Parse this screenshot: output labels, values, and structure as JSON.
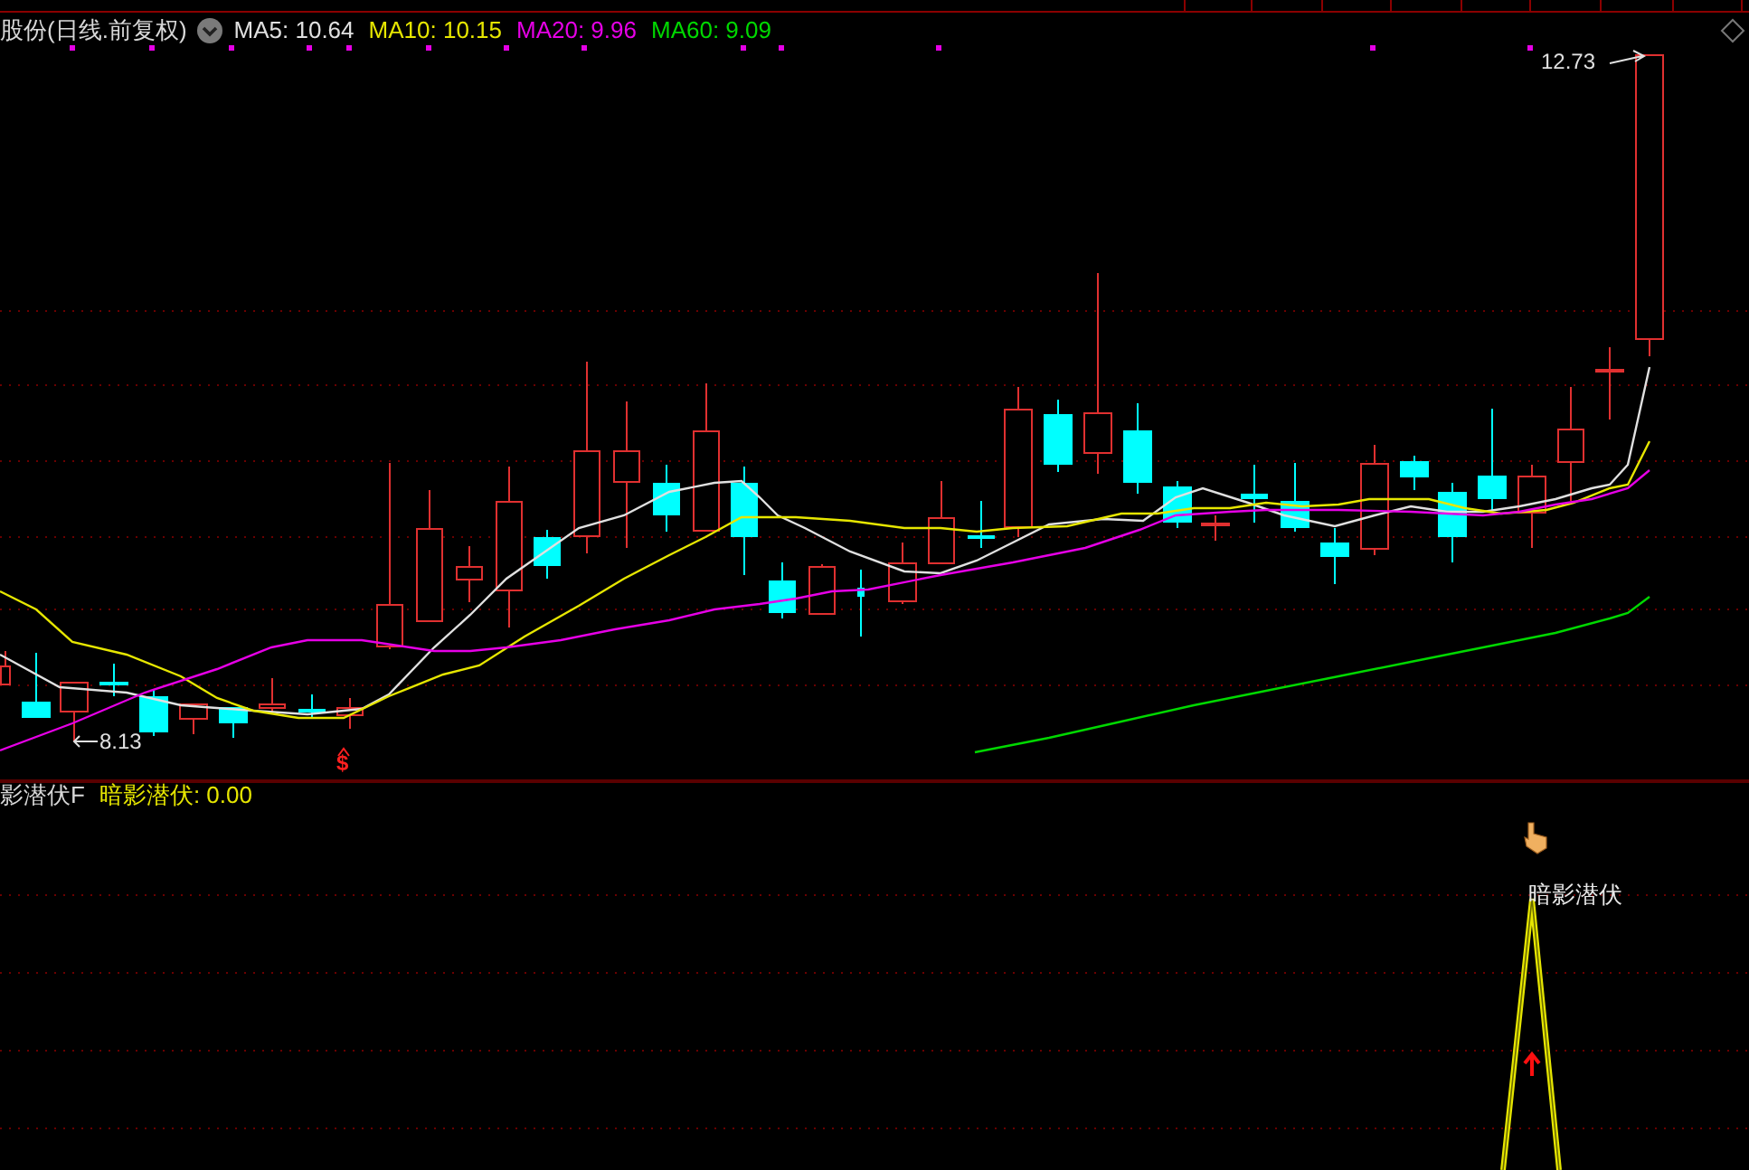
{
  "main_panel": {
    "title": "股份(日线.前复权)",
    "indicators": [
      {
        "label": "MA5: 10.64",
        "color": "#e0e0e0"
      },
      {
        "label": "MA10: 10.15",
        "color": "#e6e600"
      },
      {
        "label": "MA20: 9.96",
        "color": "#e600e6"
      },
      {
        "label": "MA60: 9.09",
        "color": "#00d800"
      }
    ],
    "high_label": "12.73",
    "low_label": "8.13",
    "signal_marker": "$"
  },
  "lower_panel": {
    "title": "影潜伏F",
    "indicator": "暗影潜伏: 0.00",
    "peak_label": "暗影潜伏"
  }
}
